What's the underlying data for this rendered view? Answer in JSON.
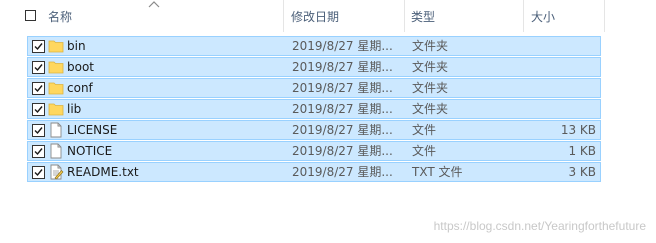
{
  "header": {
    "name": "名称",
    "date_modified": "修改日期",
    "type": "类型",
    "size": "大小"
  },
  "files": [
    {
      "name": "bin",
      "date": "2019/8/27 星期...",
      "type": "文件夹",
      "size": "",
      "icon": "folder-icon",
      "checked": true
    },
    {
      "name": "boot",
      "date": "2019/8/27 星期...",
      "type": "文件夹",
      "size": "",
      "icon": "folder-icon",
      "checked": true
    },
    {
      "name": "conf",
      "date": "2019/8/27 星期...",
      "type": "文件夹",
      "size": "",
      "icon": "folder-icon",
      "checked": true
    },
    {
      "name": "lib",
      "date": "2019/8/27 星期...",
      "type": "文件夹",
      "size": "",
      "icon": "folder-icon",
      "checked": true
    },
    {
      "name": "LICENSE",
      "date": "2019/8/27 星期...",
      "type": "文件",
      "size": "13 KB",
      "icon": "file-icon",
      "checked": true
    },
    {
      "name": "NOTICE",
      "date": "2019/8/27 星期...",
      "type": "文件",
      "size": "1 KB",
      "icon": "file-icon",
      "checked": true
    },
    {
      "name": "README.txt",
      "date": "2019/8/27 星期...",
      "type": "TXT 文件",
      "size": "3 KB",
      "icon": "text-file-icon",
      "checked": true
    }
  ],
  "watermark": "https://blog.csdn.net/Yearingforthefuture",
  "colors": {
    "selection_bg": "#cce8ff",
    "selection_border": "#99d1ff",
    "header_text": "#4c607a",
    "folder": "#ffd75e"
  }
}
